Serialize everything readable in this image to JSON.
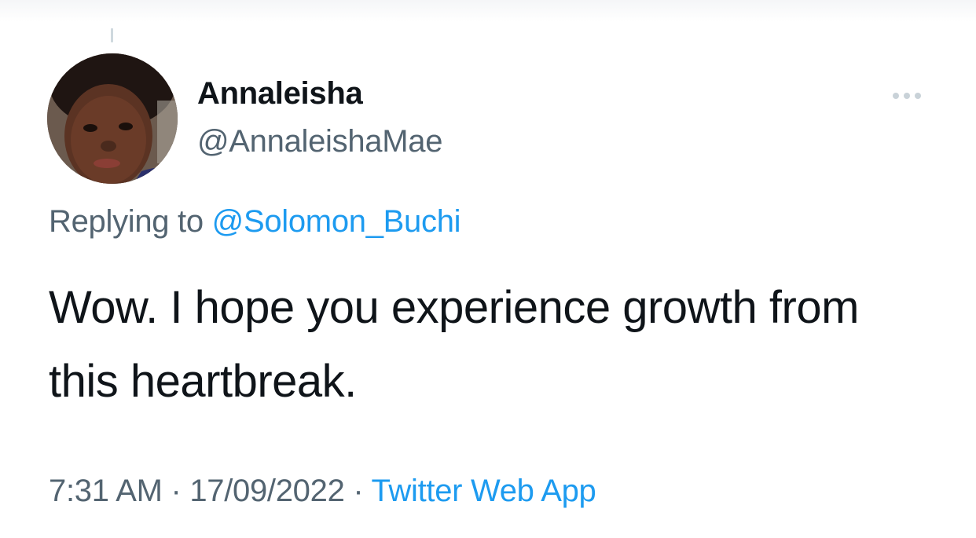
{
  "tweet": {
    "author": {
      "display_name": "Annaleisha",
      "handle": "@AnnaleishaMae"
    },
    "reply": {
      "prefix": "Replying to ",
      "to_handle": "@Solomon_Buchi"
    },
    "text": "Wow. I hope you experience growth from this heartbreak.",
    "meta": {
      "time": "7:31 AM",
      "separator_1": " · ",
      "date": "17/09/2022",
      "separator_2": " · ",
      "source": "Twitter Web App"
    }
  },
  "icons": {
    "more": "more-horizontal-icon"
  },
  "colors": {
    "text_primary": "#0f1419",
    "text_secondary": "#536471",
    "link": "#1d9bf0",
    "background": "#ffffff"
  }
}
